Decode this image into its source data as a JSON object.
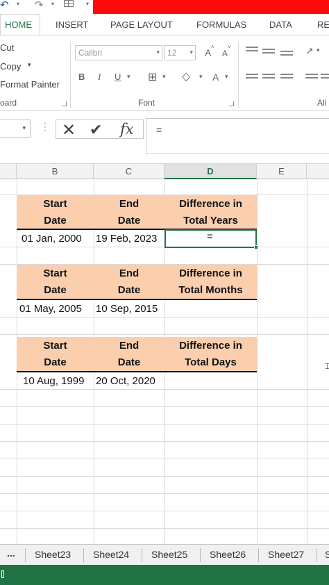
{
  "ribbon_tabs": [
    "HOME",
    "INSERT",
    "PAGE LAYOUT",
    "FORMULAS",
    "DATA",
    "RE"
  ],
  "clipboard": {
    "cut": "Cut",
    "copy": "Copy",
    "format_painter": "Format Painter",
    "label": "oard"
  },
  "font": {
    "name": "Calibri",
    "size": "12",
    "bold": "B",
    "italic": "I",
    "underline": "U",
    "grow": "A",
    "shrink": "A",
    "color_a": "A",
    "label": "Font"
  },
  "alignment": {
    "label": "Ali"
  },
  "formula_bar": {
    "fx": "fx",
    "value": "="
  },
  "columns": [
    "B",
    "C",
    "D",
    "E"
  ],
  "active_column": "D",
  "tables": [
    {
      "headers": [
        [
          "Start",
          "Date"
        ],
        [
          "End",
          "Date"
        ],
        [
          "Difference in",
          "Total Years"
        ]
      ],
      "row": [
        "01 Jan, 2000",
        "19 Feb, 2023",
        "="
      ]
    },
    {
      "headers": [
        [
          "Start",
          "Date"
        ],
        [
          "End",
          "Date"
        ],
        [
          "Difference in",
          "Total Months"
        ]
      ],
      "row": [
        "01 May, 2005",
        "10 Sep, 2015",
        ""
      ]
    },
    {
      "headers": [
        [
          "Start",
          "Date"
        ],
        [
          "End",
          "Date"
        ],
        [
          "Difference in",
          "Total Days"
        ]
      ],
      "row": [
        "10 Aug, 1999",
        "20 Oct, 2020",
        ""
      ]
    }
  ],
  "sheet_tabs": [
    "...",
    "Sheet23",
    "Sheet24",
    "Sheet25",
    "Sheet26",
    "Sheet27",
    "S"
  ],
  "colors": {
    "accent": "#217346",
    "title_bar": "#ff0a0a",
    "header_fill": "#fbcfae"
  }
}
